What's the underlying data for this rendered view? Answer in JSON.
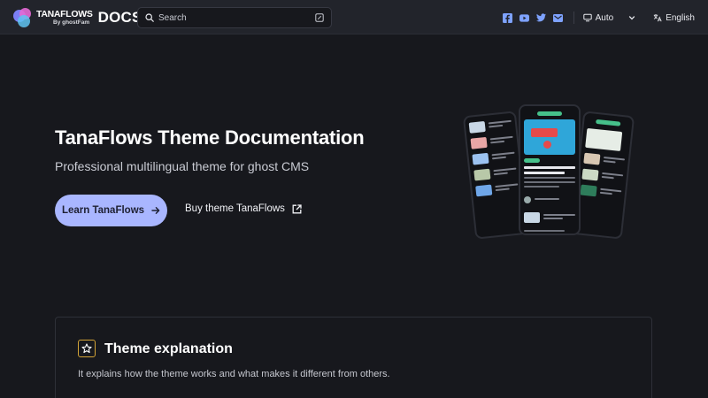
{
  "navbar": {
    "brand_name": "TANAFLOWS",
    "brand_by": "By ghostFam",
    "brand_docs": "DOCS",
    "search_placeholder": "Search",
    "social_icons": [
      "facebook-icon",
      "youtube-icon",
      "twitter-icon",
      "email-icon"
    ],
    "theme_select": {
      "value": "Auto",
      "icon": "monitor-icon"
    },
    "language_select": {
      "value": "English",
      "icon": "translate-icon"
    }
  },
  "hero": {
    "title": "TanaFlows Theme Documentation",
    "subtitle": "Professional multilingual theme for ghost CMS",
    "primary_button": "Learn TanaFlows",
    "secondary_button": "Buy theme TanaFlows"
  },
  "card": {
    "icon": "star-icon",
    "title": "Theme explanation",
    "description": "It explains how the theme works and what makes it different from others."
  },
  "colors": {
    "background": "#17181d",
    "navbar": "#22242b",
    "accent": "#a9b6ff",
    "card_icon": "#d4a437"
  }
}
